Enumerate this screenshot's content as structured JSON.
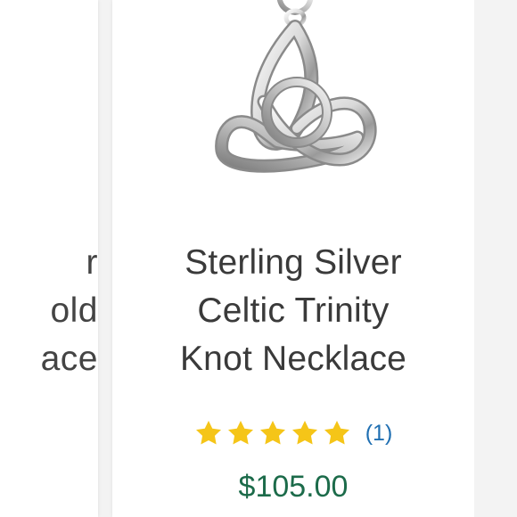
{
  "left_card": {
    "title_lines": [
      "r",
      "old",
      "ace"
    ]
  },
  "product": {
    "image_icon": "celtic-trinity-knot-pendant",
    "title_lines": [
      "Sterling Silver",
      "Celtic Trinity",
      "Knot Necklace"
    ],
    "rating": {
      "stars": 5,
      "max_stars": 5,
      "review_count": "(1)",
      "star_color": "#f5c518"
    },
    "price": "$105.00",
    "price_color": "#1c6b4a",
    "link_color": "#1f6fb2"
  }
}
